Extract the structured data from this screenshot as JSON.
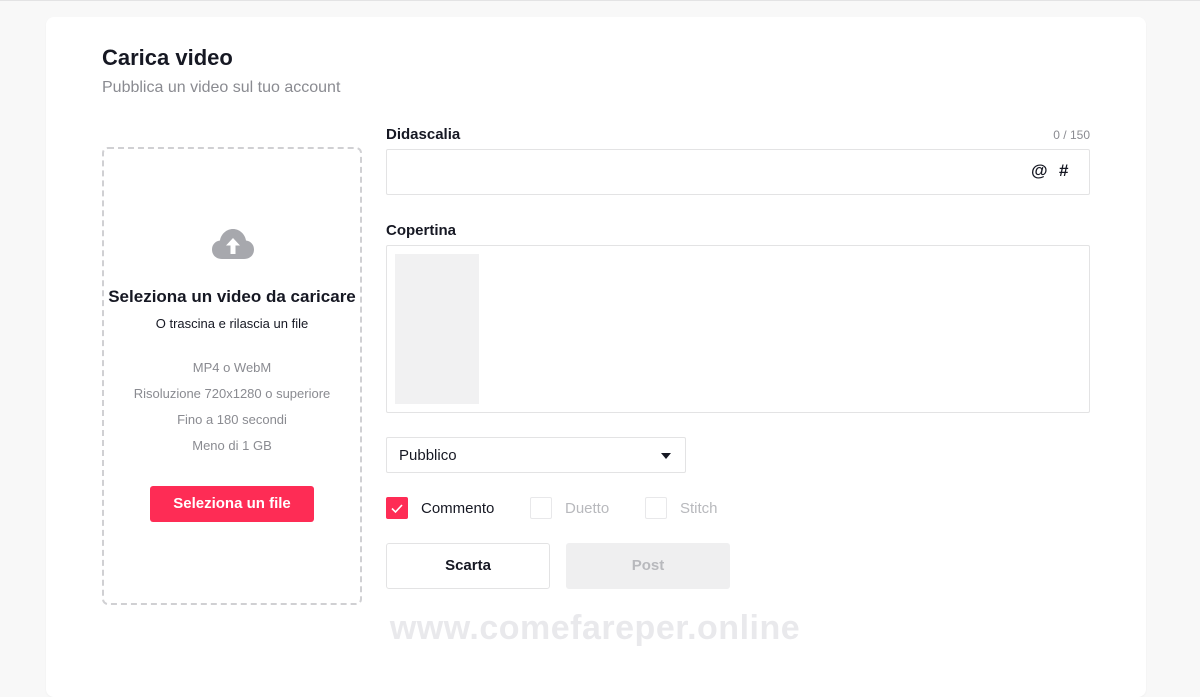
{
  "header": {
    "title": "Carica video",
    "subtitle": "Pubblica un video sul tuo account"
  },
  "upload": {
    "icon": "cloud-upload-icon",
    "title": "Seleziona un video da caricare",
    "hint": "O trascina e rilascia un file",
    "specs": [
      "MP4 o WebM",
      "Risoluzione 720x1280 o superiore",
      "Fino a 180 secondi",
      "Meno di 1 GB"
    ],
    "button_label": "Seleziona un file"
  },
  "caption": {
    "label": "Didascalia",
    "counter": "0 / 150",
    "value": "",
    "mention_symbol": "@",
    "hashtag_symbol": "#"
  },
  "cover": {
    "label": "Copertina"
  },
  "privacy": {
    "selected": "Pubblico"
  },
  "permissions": [
    {
      "label": "Commento",
      "checked": true
    },
    {
      "label": "Duetto",
      "checked": false
    },
    {
      "label": "Stitch",
      "checked": false
    }
  ],
  "actions": {
    "discard_label": "Scarta",
    "post_label": "Post"
  },
  "watermark": "www.comefareper.online",
  "colors": {
    "accent": "#fe2c55",
    "muted_text": "#8a8b91",
    "border": "#e3e3e4",
    "disabled_bg": "#efeff0"
  }
}
